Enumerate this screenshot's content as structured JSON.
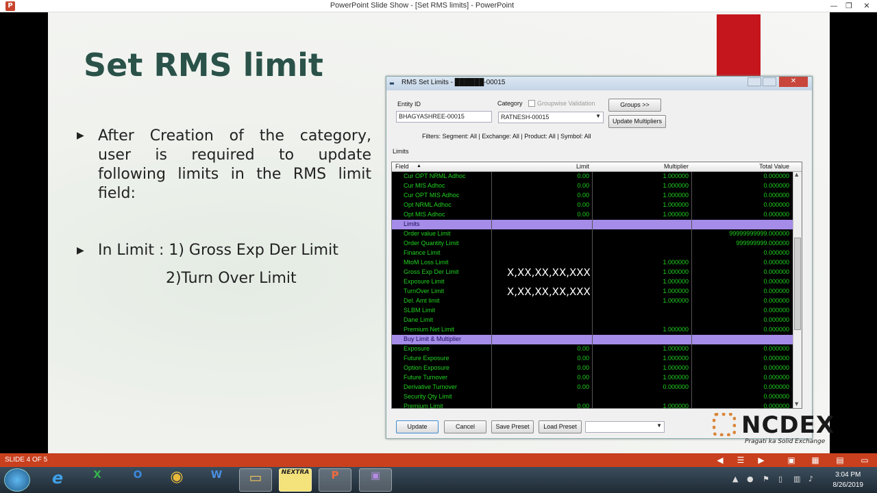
{
  "window": {
    "title": "PowerPoint Slide Show - [Set RMS limits] - PowerPoint",
    "logo": "P"
  },
  "slide": {
    "title": "Set RMS limit",
    "bullet1_lines": [
      "After Creation of the category,",
      "user is required to update",
      "following limits in the RMS limit",
      "field:"
    ],
    "bullet2": "In Limit : 1) Gross Exp Der Limit",
    "bullet2_sub": "2)Turn Over Limit",
    "bullet_marker": "▶"
  },
  "dialog": {
    "title": "RMS Set Limits - ██████-00015",
    "entity_label": "Entity ID",
    "entity_value": "BHAGYASHREE-00015",
    "category_label": "Category",
    "groupwise_label": "Groupwise Validation",
    "category_value": "RATNESH-00015",
    "groups_btn": "Groups >>",
    "update_mult_btn": "Update Multipliers",
    "filters": "Filters:  Segment: All | Exchange: All | Product: All | Symbol: All",
    "limits_label": "Limits",
    "headers": {
      "field": "Field",
      "limit": "Limit",
      "multiplier": "Multiplier",
      "total": "Total Value"
    },
    "rows": [
      {
        "f": "Cur OPT NRML Adhoc",
        "l": "0.00",
        "m": "1.000000",
        "t": "0.000000"
      },
      {
        "f": "Cur MIS Adhoc",
        "l": "0.00",
        "m": "1.000000",
        "t": "0.000000"
      },
      {
        "f": "Cur OPT MIS Adhoc",
        "l": "0.00",
        "m": "1.000000",
        "t": "0.000000"
      },
      {
        "f": "Opt NRML Adhoc",
        "l": "0.00",
        "m": "1.000000",
        "t": "0.000000"
      },
      {
        "f": "Opt MIS Adhoc",
        "l": "0.00",
        "m": "1.000000",
        "t": "0.000000"
      },
      {
        "f": "Limits",
        "group": true
      },
      {
        "f": "Order value Limit",
        "l": "",
        "m": "",
        "t": "99999999999.000000"
      },
      {
        "f": "Order Quantity Limit",
        "l": "",
        "m": "",
        "t": "999999999.000000"
      },
      {
        "f": "Finance Limit",
        "l": "",
        "m": "",
        "t": "0.000000"
      },
      {
        "f": "MtoM Loss Limit",
        "l": "",
        "m": "1.000000",
        "t": "0.000000"
      },
      {
        "f": "Gross Exp Der Limit",
        "l": "",
        "m": "1.000000",
        "t": "0.000000"
      },
      {
        "f": "Exposure Limit",
        "l": "",
        "m": "1.000000",
        "t": "0.000000"
      },
      {
        "f": "TurnOver Limit",
        "l": "",
        "m": "1.000000",
        "t": "0.000000"
      },
      {
        "f": "Del. Amt limit",
        "l": "",
        "m": "1.000000",
        "t": "0.000000"
      },
      {
        "f": "SLBM Limit",
        "l": "",
        "m": "",
        "t": "0.000000"
      },
      {
        "f": "Dane Limit",
        "l": "",
        "m": "",
        "t": "0.000000"
      },
      {
        "f": "Premium Net Limit",
        "l": "",
        "m": "1.000000",
        "t": "0.000000"
      },
      {
        "f": "Buy Limit & Multiplier",
        "group": true
      },
      {
        "f": "Exposure",
        "l": "0.00",
        "m": "1.000000",
        "t": "0.000000"
      },
      {
        "f": "Future Exposure",
        "l": "0.00",
        "m": "1.000000",
        "t": "0.000000"
      },
      {
        "f": "Option Exposure",
        "l": "0.00",
        "m": "1.000000",
        "t": "0.000000"
      },
      {
        "f": "Future Turnover",
        "l": "0.00",
        "m": "1.000000",
        "t": "0.000000"
      },
      {
        "f": "Derivative Turnover",
        "l": "0.00",
        "m": "0.000000",
        "t": "0.000000"
      },
      {
        "f": "Security Qty Limit",
        "l": "",
        "m": "",
        "t": "0.000000"
      },
      {
        "f": "Premium Limit",
        "l": "0.00",
        "m": "1.000000",
        "t": "0.000000"
      }
    ],
    "overlay_text": "X,XX,XX,XX,XXX",
    "buttons": {
      "update": "Update",
      "cancel": "Cancel",
      "save": "Save Preset",
      "load": "Load Preset"
    }
  },
  "ncdex": {
    "word": "NCDEX",
    "tagline": "Pragati ka Solid Exchange"
  },
  "status": {
    "slide_num": "SLIDE 4 OF 5"
  },
  "clock": {
    "time": "3:04 PM",
    "date": "8/26/2019"
  },
  "taskbar": [
    {
      "name": "ie",
      "label": "e"
    },
    {
      "name": "excel",
      "label": "X"
    },
    {
      "name": "outlook",
      "label": "O"
    },
    {
      "name": "chrome",
      "label": "◉"
    },
    {
      "name": "word",
      "label": "W"
    },
    {
      "name": "explorer",
      "label": "▭"
    },
    {
      "name": "nextra",
      "label": "NEXTRA"
    },
    {
      "name": "powerpoint",
      "label": "P"
    },
    {
      "name": "teams",
      "label": "▣"
    }
  ]
}
